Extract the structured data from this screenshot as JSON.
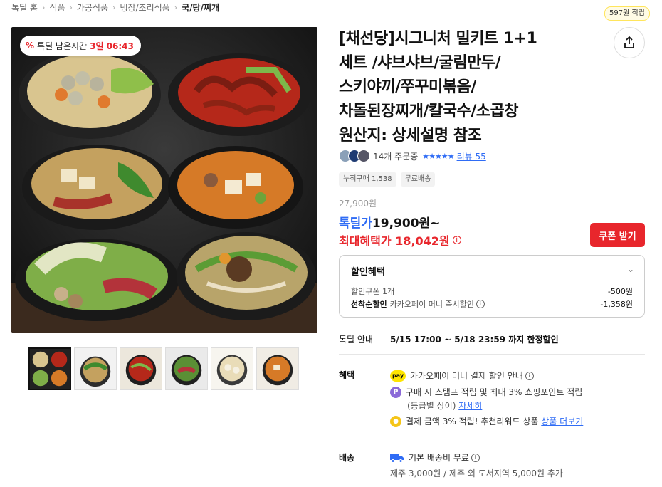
{
  "breadcrumb": [
    "톡딜 홈",
    "식품",
    "가공식품",
    "냉장/조리식품",
    "국/탕/찌개"
  ],
  "deal_badge": {
    "label": "톡딜 남은시간",
    "time": "3일 06:43",
    "icon": "percent-icon"
  },
  "product": {
    "title_lines": [
      "[채선당]시그니처 밀키트 1+1",
      "세트 /샤브샤브/굴림만두/",
      "스키야끼/쭈꾸미볶음/",
      "차돌된장찌개/칼국수/소곱창",
      "원산지: 상세설명 참조"
    ]
  },
  "points_badge": "597원 적립",
  "share_icon": "share-icon",
  "orders": {
    "count_text": "14개 주문중",
    "stars": "★★★★★",
    "review_link": "리뷰 55"
  },
  "chips": [
    "누적구매 1,538",
    "무료배송"
  ],
  "price": {
    "original": "27,900원",
    "deal_label": "톡딜가",
    "deal_value": "19,900원~",
    "max_label": "최대혜택가",
    "max_value": "18,042원"
  },
  "coupon_button": "쿠폰 받기",
  "discount": {
    "header": "할인혜택",
    "rows": [
      {
        "label": "할인쿠폰 1개",
        "value": "-500원"
      },
      {
        "label_bold": "선착순할인",
        "label": "카카오페이 머니 즉시할인",
        "value": "-1,358원"
      }
    ]
  },
  "deal_info": {
    "label": "톡딜 안내",
    "value": "5/15 17:00 ~ 5/18 23:59 까지 한정할인"
  },
  "benefits": {
    "label": "혜택",
    "items": [
      {
        "icon": "kakaopay-icon",
        "icon_text": "pay",
        "text": "카카오페이 머니 결제 할인 안내"
      },
      {
        "icon": "point-p-icon",
        "icon_text": "P",
        "text": "구매 시 스탬프 적립 및 최대 3% 쇼핑포인트 적립",
        "sub": "(등급별 상이)",
        "sub_link": "자세히"
      },
      {
        "icon": "coin-icon",
        "icon_text": "",
        "text": "결제 금액 3% 적립! 추천리워드 상품",
        "link": "상품 더보기"
      }
    ]
  },
  "shipping": {
    "label": "배송",
    "icon": "truck-icon",
    "text": "기본 배송비 무료",
    "sub": "제주 3,000원 / 제주 외 도서지역 5,000원 추가"
  },
  "colors": {
    "accent_red": "#e8262c",
    "accent_blue": "#2f6cf5",
    "kakao_yellow": "#fee500"
  }
}
